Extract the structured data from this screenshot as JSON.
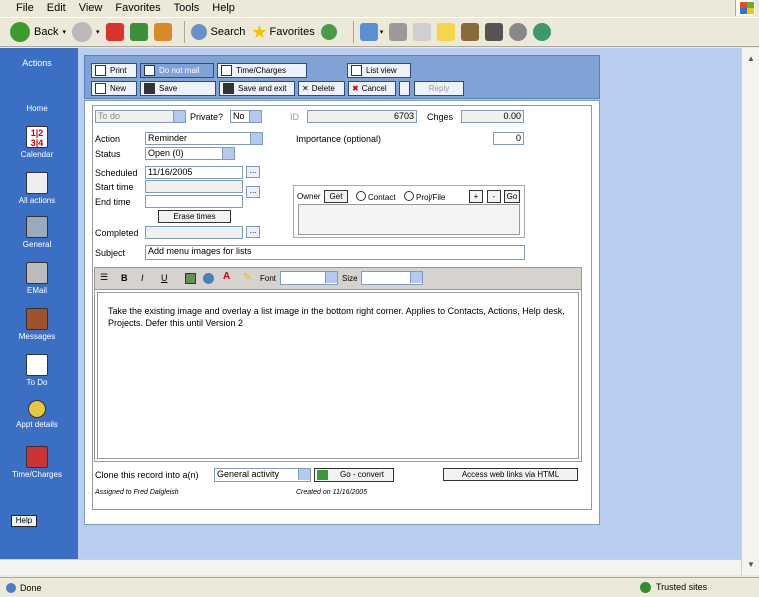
{
  "menu": [
    "File",
    "Edit",
    "View",
    "Favorites",
    "Tools",
    "Help"
  ],
  "toolbar": {
    "back": "Back",
    "search": "Search",
    "favorites": "Favorites"
  },
  "sidebar": {
    "title": "Actions",
    "items": [
      {
        "label": "Home"
      },
      {
        "label": "Calendar",
        "icon": "calendar-icon",
        "cal_text": "1|2 3|4"
      },
      {
        "label": "All actions"
      },
      {
        "label": "General"
      },
      {
        "label": "EMail"
      },
      {
        "label": "Messages"
      },
      {
        "label": "To Do"
      },
      {
        "label": "Appt details"
      },
      {
        "label": "Time/Charges"
      }
    ],
    "help": "Help"
  },
  "buttons": {
    "print": "Print",
    "donotmail": "Do not mail",
    "timecharges": "Time/Charges",
    "listview": "List view",
    "new": "New",
    "save": "Save",
    "saveexit": "Save and exit",
    "delete": "Delete",
    "cancel": "Cancel",
    "reply": "Reply"
  },
  "form": {
    "type_value": "To do",
    "private_label": "Private?",
    "private_value": "No",
    "id_label": "ID",
    "id_value": "6703",
    "chges_label": "Chges",
    "chges_value": "0.00",
    "action_label": "Action",
    "action_value": "Reminder",
    "importance_label": "Importance (optional)",
    "importance_value": "0",
    "status_label": "Status",
    "status_value": "Open (0)",
    "scheduled_label": "Scheduled",
    "scheduled_value": "11/16/2005",
    "ell": "...",
    "start_label": "Start time",
    "end_label": "End time",
    "erase": "Erase times",
    "completed_label": "Completed",
    "owner_label": "Owner",
    "get": "Get",
    "contact": "Contact",
    "projfile": "Proj/File",
    "plus": "+",
    "minus": "-",
    "go": "Go",
    "subject_label": "Subject",
    "subject_value": "Add menu images for lists",
    "font_label": "Font",
    "size_label": "Size",
    "body": "Take the existing image and overlay a list image in the bottom right corner. Applies to Contacts, Actions, Help desk, Projects. Defer this until Version 2",
    "clone_label": "Clone this record into a(n)",
    "clone_value": "General activity",
    "goconvert": "Go - convert",
    "weblinks": "Access web links via HTML",
    "assigned": "Assigned to Fred Dalgleish",
    "created": "Created on 11/16/2005"
  },
  "status": {
    "done": "Done",
    "zone": "Trusted sites"
  }
}
